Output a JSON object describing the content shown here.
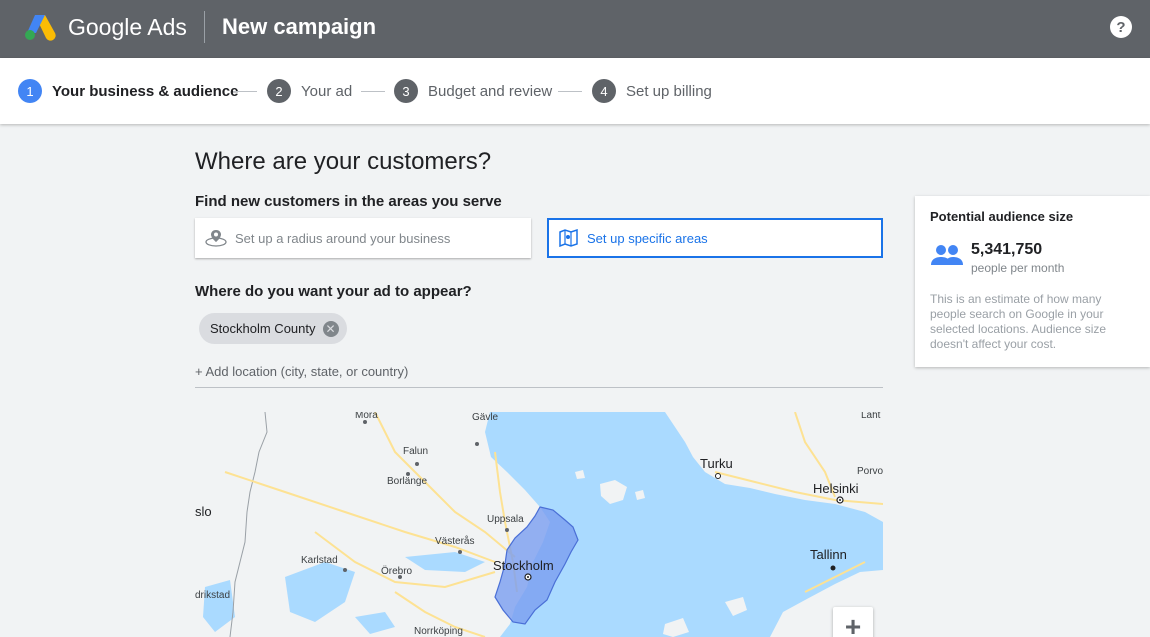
{
  "header": {
    "brand": "Google Ads",
    "title": "New campaign",
    "help": "?"
  },
  "stepper": {
    "steps": [
      {
        "num": "1",
        "label": "Your business & audience"
      },
      {
        "num": "2",
        "label": "Your ad"
      },
      {
        "num": "3",
        "label": "Budget and review"
      },
      {
        "num": "4",
        "label": "Set up billing"
      }
    ],
    "active_step": 1
  },
  "main": {
    "heading": "Where are your customers?",
    "find_heading": "Find new customers in the areas you serve",
    "options": {
      "radius": "Set up a radius around your business",
      "areas": "Set up specific areas"
    },
    "appear_heading": "Where do you want your ad to appear?",
    "chip": "Stockholm County",
    "add_location": "+ Add location (city, state, or country)"
  },
  "map": {
    "labels": {
      "mora": "Mora",
      "gavle": "Gävle",
      "falun": "Falun",
      "borlange": "Borlänge",
      "uppsala": "Uppsala",
      "vasteras": "Västerås",
      "karlstad": "Karlstad",
      "orebro": "Örebro",
      "stockholm": "Stockholm",
      "norrkoping": "Norrköping",
      "turku": "Turku",
      "helsinki": "Helsinki",
      "tallinn": "Tallinn",
      "lahti": "Laht",
      "porvoo": "Porvo",
      "oslo": "slo",
      "drikstad": "drikstad"
    },
    "zoom_in": "+",
    "colors": {
      "water": "#aadaff",
      "land": "#f1f3f4",
      "region": "#7b9ef0"
    }
  },
  "audience": {
    "title": "Potential audience size",
    "number": "5,341,750",
    "unit": "people per month",
    "note": "This is an estimate of how many people search on Google in your selected locations. Audience size doesn't affect your cost.",
    "icon": "people-icon"
  }
}
